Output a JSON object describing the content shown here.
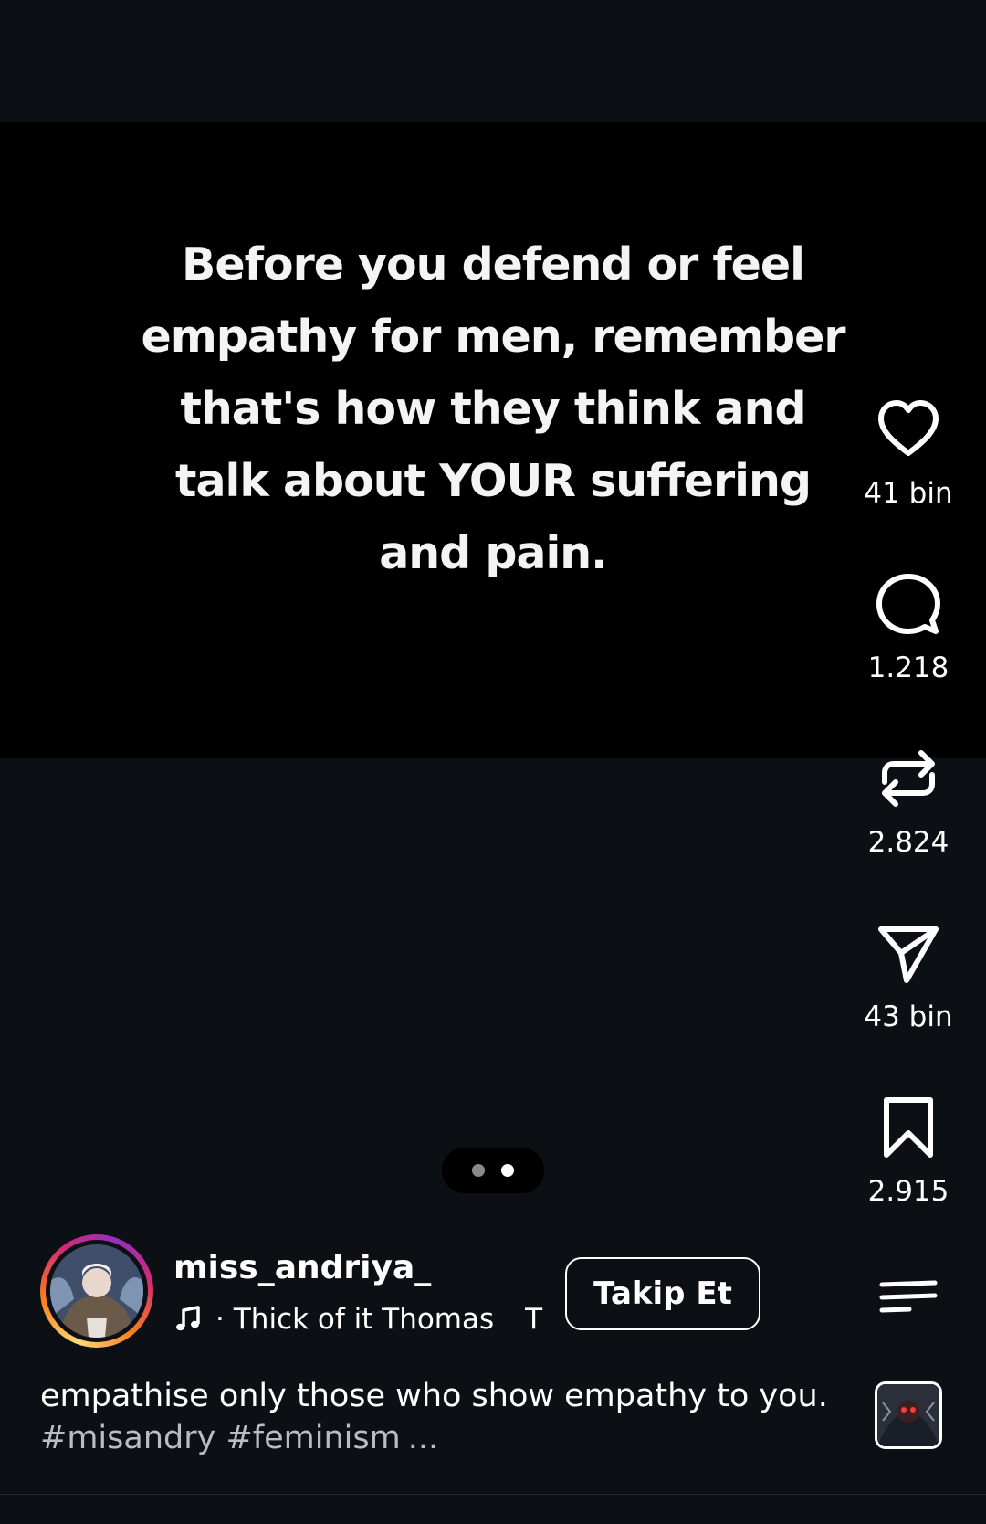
{
  "post": {
    "text": "Before you defend or feel\nempathy for men, remember\nthat's how they think and\ntalk about YOUR suffering\nand pain."
  },
  "actions": {
    "like": {
      "icon": "heart-icon",
      "count": "41 bin"
    },
    "comment": {
      "icon": "comment-icon",
      "count": "1.218"
    },
    "repost": {
      "icon": "repost-icon",
      "count": "2.824"
    },
    "share": {
      "icon": "send-icon",
      "count": "43 bin"
    },
    "save": {
      "icon": "bookmark-icon",
      "count": "2.915"
    },
    "more": {
      "icon": "menu-icon"
    }
  },
  "pager": {
    "total": 2,
    "active": 2
  },
  "author": {
    "username": "miss_andriya_",
    "follow_label": "Takip Et"
  },
  "music": {
    "icon": "music-note-icon",
    "separator": "·",
    "title": "Thick of it Thomas",
    "extra": "T"
  },
  "caption": {
    "text": "empathise only those who show empathy to you.",
    "hashtags": "#misandry #feminism",
    "more": "..."
  },
  "colors": {
    "background": "#0c0f14",
    "media_background": "#000000",
    "text": "#ffffff",
    "hashtag": "#b9bcc2"
  }
}
